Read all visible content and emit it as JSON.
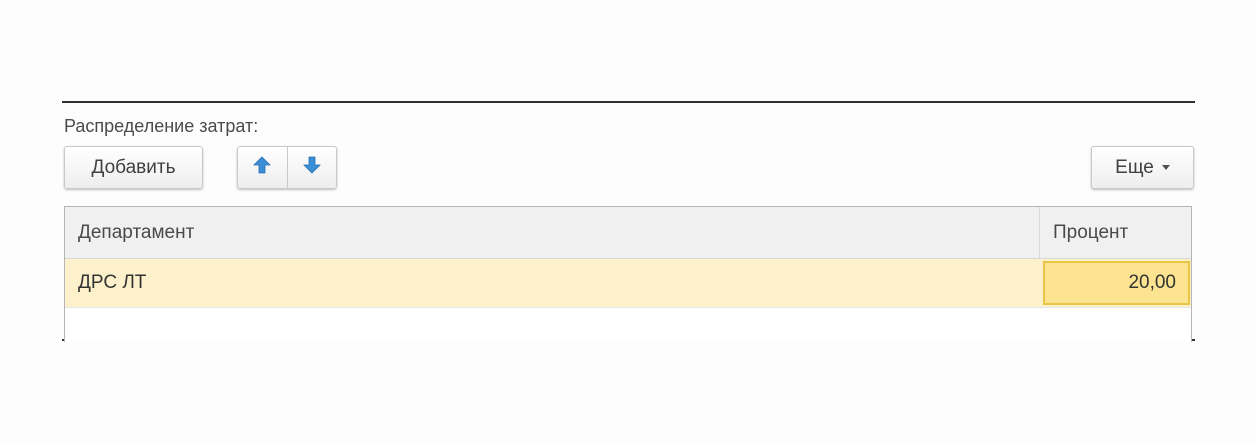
{
  "section": {
    "label": "Распределение затрат:"
  },
  "toolbar": {
    "add_label": "Добавить",
    "up_icon": "arrow-up-icon",
    "down_icon": "arrow-down-icon",
    "more_label": "Еще",
    "more_icon": "caret-down-icon"
  },
  "table": {
    "columns": [
      "Департамент",
      "Процент"
    ],
    "rows": [
      {
        "department": "ДРС ЛТ",
        "percent": "20,00"
      }
    ]
  },
  "colors": {
    "arrow": "#3b8fd6",
    "row_selected": "#fdf1cc",
    "cell_active": "#fbe38f",
    "cell_active_border": "#e8c545"
  }
}
